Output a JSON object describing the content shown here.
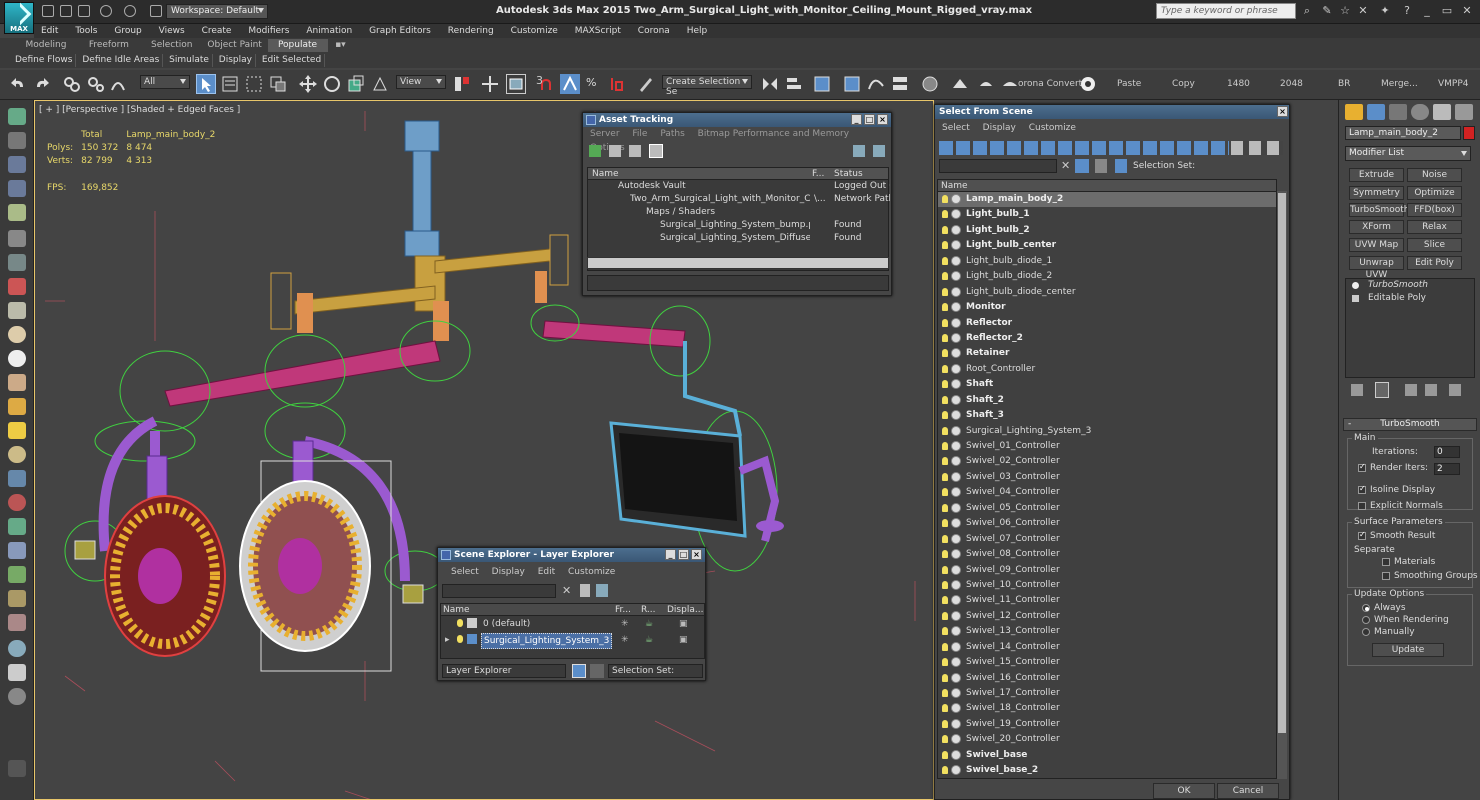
{
  "titlebar": {
    "logo_text": "MAX",
    "workspace": "Workspace: Default",
    "title": "Autodesk 3ds Max  2015    Two_Arm_Surgical_Light_with_Monitor_Ceiling_Mount_Rigged_vray.max",
    "search_placeholder": "Type a keyword or phrase"
  },
  "menu": [
    "Edit",
    "Tools",
    "Group",
    "Views",
    "Create",
    "Modifiers",
    "Animation",
    "Graph Editors",
    "Rendering",
    "Customize",
    "MAXScript",
    "Corona",
    "Help"
  ],
  "ribbon": {
    "tabs": [
      "Modeling",
      "Freeform",
      "Selection",
      "Object Paint",
      "Populate"
    ],
    "active_tab": "Populate",
    "subtabs": [
      "Define Flows",
      "Define Idle Areas",
      "Simulate",
      "Display",
      "Edit Selected"
    ]
  },
  "toolbar": {
    "filter": "All",
    "refcoord": "View",
    "snap_value": "3",
    "selection_set": "Create Selection Se",
    "corona_label": "orona Convert",
    "paste": "Paste",
    "copy": "Copy",
    "val1": "1480",
    "val2": "2048",
    "br": "BR",
    "merge": "Merge...",
    "vmpp": "VMPP4"
  },
  "viewport": {
    "label": "[ + ] [Perspective ] [Shaded + Edged Faces ]",
    "stats": {
      "total_label": "Total",
      "object": "Lamp_main_body_2",
      "polys_label": "Polys:",
      "polys_total": "150 372",
      "polys_obj": "8 474",
      "verts_label": "Verts:",
      "verts_total": "82 799",
      "verts_obj": "4 313",
      "fps_label": "FPS:",
      "fps": "169,852"
    }
  },
  "asset_tracking": {
    "title": "Asset Tracking",
    "menu": [
      "Server",
      "File",
      "Paths",
      "Bitmap Performance and Memory",
      "Options"
    ],
    "columns": [
      "Name",
      "F...",
      "Status"
    ],
    "rows": [
      {
        "name": "Autodesk Vault",
        "f": "",
        "status": "Logged Out (..."
      },
      {
        "name": "Two_Arm_Surgical_Light_with_Monitor_Ceilin...",
        "f": "\\...",
        "status": "Network Path"
      },
      {
        "name": "Maps / Shaders",
        "f": "",
        "status": ""
      },
      {
        "name": "Surgical_Lighting_System_bump.png",
        "f": "",
        "status": "Found"
      },
      {
        "name": "Surgical_Lighting_System_Diffuse.png",
        "f": "",
        "status": "Found"
      }
    ]
  },
  "select_from_scene": {
    "title": "Select From Scene",
    "menu": [
      "Select",
      "Display",
      "Customize"
    ],
    "selection_set_label": "Selection Set:",
    "column": "Name",
    "items": [
      {
        "name": "Lamp_main_body_2",
        "bold": true,
        "selected": true
      },
      {
        "name": "Light_bulb_1",
        "bold": true
      },
      {
        "name": "Light_bulb_2",
        "bold": true
      },
      {
        "name": "Light_bulb_center",
        "bold": true
      },
      {
        "name": "Light_bulb_diode_1",
        "bold": false
      },
      {
        "name": "Light_bulb_diode_2",
        "bold": false
      },
      {
        "name": "Light_bulb_diode_center",
        "bold": false
      },
      {
        "name": "Monitor",
        "bold": true
      },
      {
        "name": "Reflector",
        "bold": true
      },
      {
        "name": "Reflector_2",
        "bold": true
      },
      {
        "name": "Retainer",
        "bold": true
      },
      {
        "name": "Root_Controller",
        "bold": false
      },
      {
        "name": "Shaft",
        "bold": true
      },
      {
        "name": "Shaft_2",
        "bold": true
      },
      {
        "name": "Shaft_3",
        "bold": true
      },
      {
        "name": "Surgical_Lighting_System_3",
        "bold": false
      },
      {
        "name": "Swivel_01_Controller",
        "bold": false
      },
      {
        "name": "Swivel_02_Controller",
        "bold": false
      },
      {
        "name": "Swivel_03_Controller",
        "bold": false
      },
      {
        "name": "Swivel_04_Controller",
        "bold": false
      },
      {
        "name": "Swivel_05_Controller",
        "bold": false
      },
      {
        "name": "Swivel_06_Controller",
        "bold": false
      },
      {
        "name": "Swivel_07_Controller",
        "bold": false
      },
      {
        "name": "Swivel_08_Controller",
        "bold": false
      },
      {
        "name": "Swivel_09_Controller",
        "bold": false
      },
      {
        "name": "Swivel_10_Controller",
        "bold": false
      },
      {
        "name": "Swivel_11_Controller",
        "bold": false
      },
      {
        "name": "Swivel_12_Controller",
        "bold": false
      },
      {
        "name": "Swivel_13_Controller",
        "bold": false
      },
      {
        "name": "Swivel_14_Controller",
        "bold": false
      },
      {
        "name": "Swivel_15_Controller",
        "bold": false
      },
      {
        "name": "Swivel_16_Controller",
        "bold": false
      },
      {
        "name": "Swivel_17_Controller",
        "bold": false
      },
      {
        "name": "Swivel_18_Controller",
        "bold": false
      },
      {
        "name": "Swivel_19_Controller",
        "bold": false
      },
      {
        "name": "Swivel_20_Controller",
        "bold": false
      },
      {
        "name": "Swivel_base",
        "bold": true
      },
      {
        "name": "Swivel_base_2",
        "bold": true
      }
    ],
    "ok": "OK",
    "cancel": "Cancel"
  },
  "scene_explorer": {
    "title": "Scene Explorer - Layer Explorer",
    "menu": [
      "Select",
      "Display",
      "Edit",
      "Customize"
    ],
    "columns": [
      "Name",
      "Fr...",
      "R...",
      "Displa..."
    ],
    "layers": [
      {
        "name": "0 (default)",
        "selected": false
      },
      {
        "name": "Surgical_Lighting_System_3",
        "selected": true
      }
    ],
    "explorer_type": "Layer Explorer",
    "selection_set_label": "Selection Set:"
  },
  "command_panel": {
    "object_name": "Lamp_main_body_2",
    "object_color": "#d22222",
    "modifier_list": "Modifier List",
    "buttons": [
      "Extrude",
      "Noise",
      "Symmetry",
      "Optimize",
      "TurboSmooth",
      "FFD(box)",
      "XForm",
      "Relax",
      "UVW Map",
      "Slice",
      "Unwrap UVW",
      "Edit Poly"
    ],
    "stack": [
      "TurboSmooth",
      "Editable Poly"
    ],
    "rollout_title": "TurboSmooth",
    "main_label": "Main",
    "iterations_label": "Iterations:",
    "iterations": "0",
    "render_iters_label": "Render Iters:",
    "render_iters": "2",
    "isoline": "Isoline Display",
    "explicit_normals": "Explicit Normals",
    "surface_params": "Surface Parameters",
    "smooth_result": "Smooth Result",
    "separate": "Separate",
    "materials": "Materials",
    "smoothing_groups": "Smoothing Groups",
    "update_options": "Update Options",
    "always": "Always",
    "when_rendering": "When Rendering",
    "manually": "Manually",
    "update": "Update"
  }
}
